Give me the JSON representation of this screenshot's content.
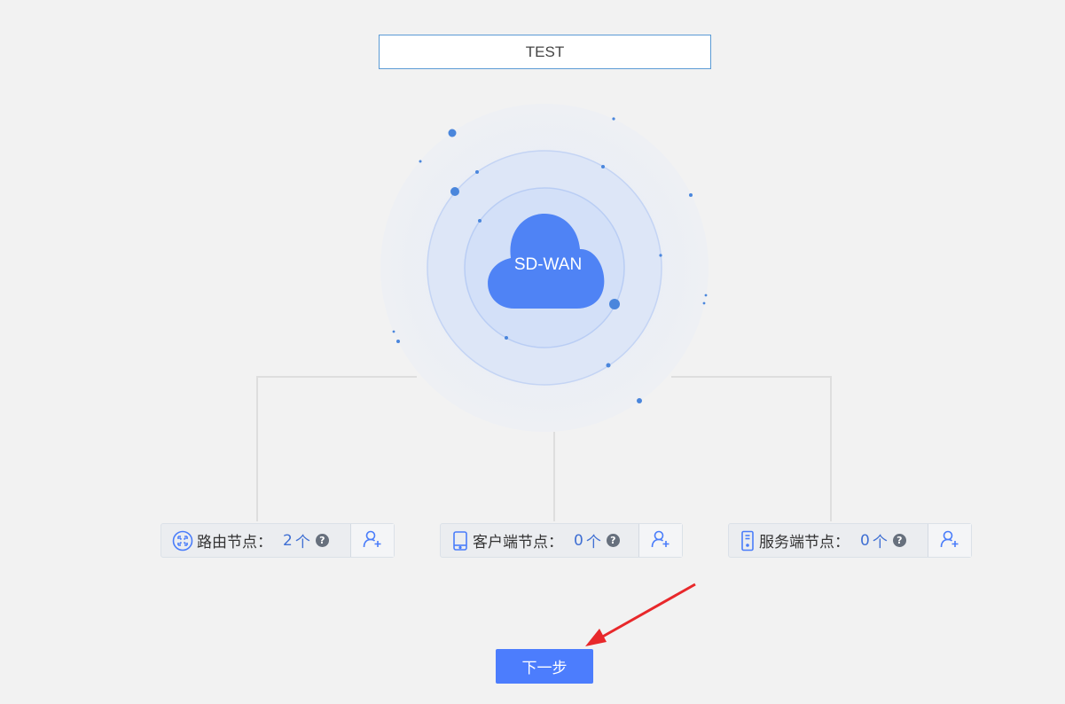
{
  "network_name": "TEST",
  "cloud_label": "SD-WAN",
  "nodes": [
    {
      "label": "路由节点：",
      "count": "2",
      "unit": "个",
      "help": "?"
    },
    {
      "label": "客户端节点：",
      "count": "0",
      "unit": "个",
      "help": "?"
    },
    {
      "label": "服务端节点：",
      "count": "0",
      "unit": "个",
      "help": "?"
    }
  ],
  "next_label": "下一步",
  "colors": {
    "accent": "#4c7dfd",
    "cloud": "#4f83f5",
    "annotation_arrow": "#e8282b"
  }
}
